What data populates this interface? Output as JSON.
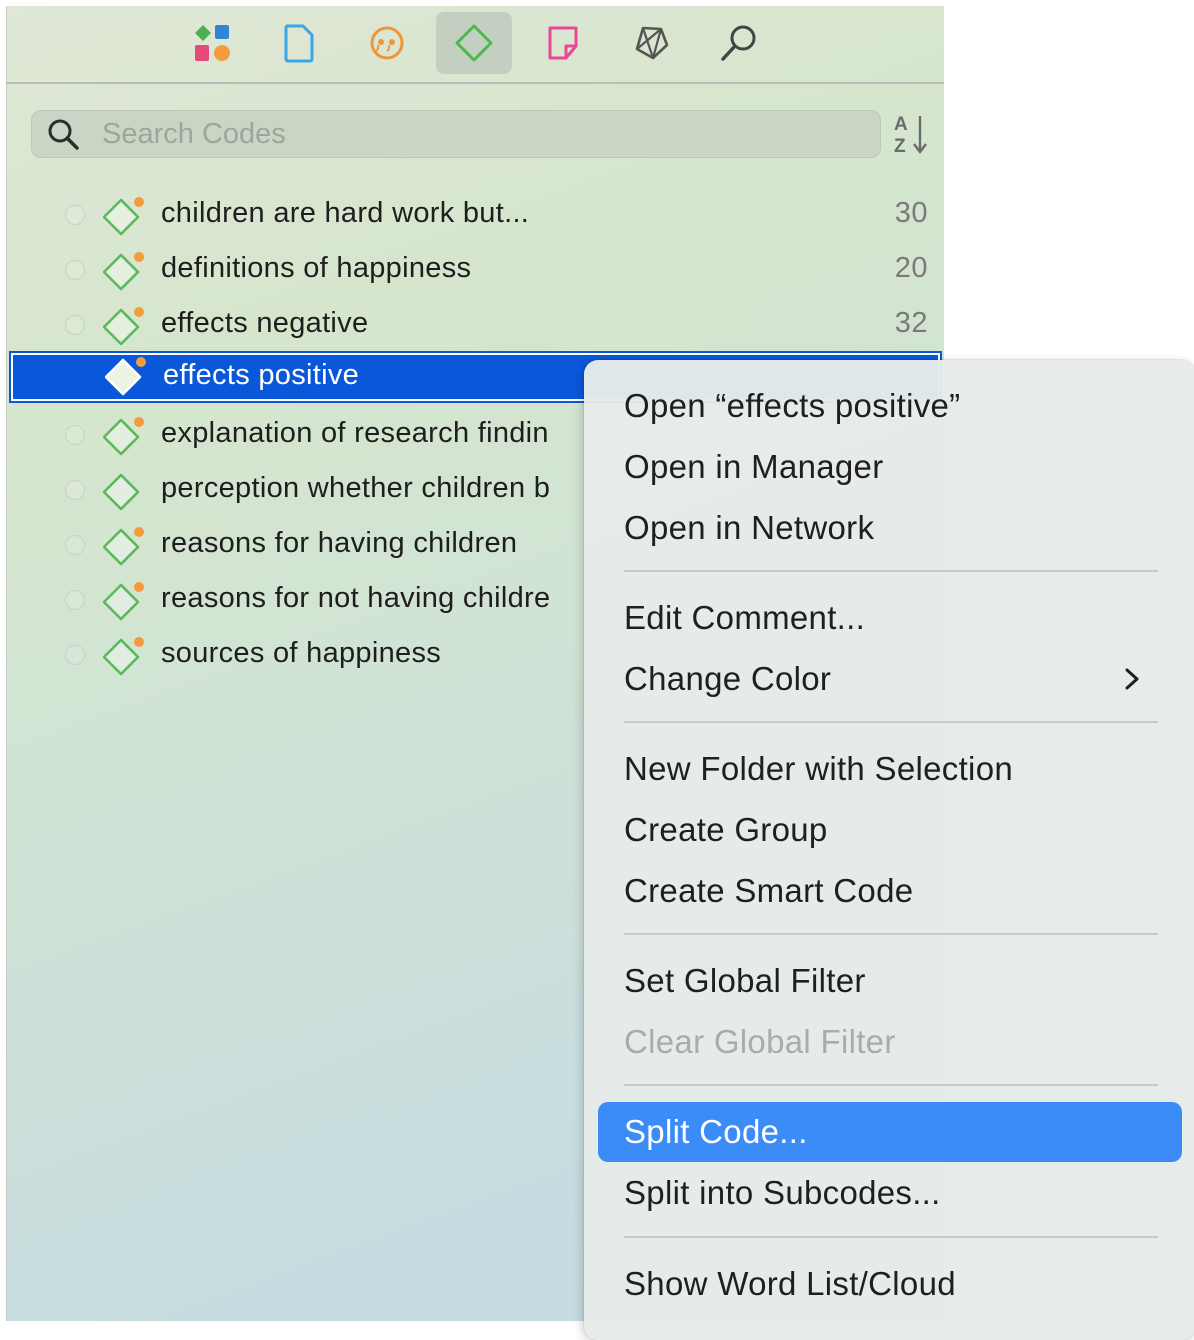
{
  "toolbar": {
    "icons": [
      {
        "name": "project-explorer-icon",
        "active": false
      },
      {
        "name": "documents-icon",
        "active": false
      },
      {
        "name": "quotations-icon",
        "active": false
      },
      {
        "name": "codes-icon",
        "active": true
      },
      {
        "name": "memos-icon",
        "active": false
      },
      {
        "name": "networks-icon",
        "active": false
      },
      {
        "name": "search-icon",
        "active": false
      }
    ]
  },
  "search": {
    "placeholder": "Search Codes",
    "value": ""
  },
  "sort_icon": "sort-az-icon",
  "codes": [
    {
      "label": "children are hard work but...",
      "count": "30"
    },
    {
      "label": "definitions of happiness",
      "count": "20"
    },
    {
      "label": "effects negative",
      "count": "32"
    },
    {
      "label": "effects positive",
      "count": "",
      "selected": true
    },
    {
      "label": "explanation of research findin",
      "count": ""
    },
    {
      "label": "perception whether children b",
      "count": ""
    },
    {
      "label": "reasons for having children",
      "count": ""
    },
    {
      "label": "reasons for not having childre",
      "count": ""
    },
    {
      "label": "sources of happiness",
      "count": ""
    }
  ],
  "context_menu": {
    "items": {
      "open": "Open “effects positive”",
      "open_manager": "Open in Manager",
      "open_network": "Open in Network",
      "edit_comment": "Edit Comment...",
      "change_color": "Change Color",
      "new_folder": "New Folder with Selection",
      "create_group": "Create Group",
      "create_smart_code": "Create Smart Code",
      "set_global_filter": "Set Global Filter",
      "clear_global_filter": "Clear Global Filter",
      "split_code": "Split Code...",
      "split_subcodes": "Split into Subcodes...",
      "word_list": "Show Word List/Cloud"
    }
  },
  "colors": {
    "selection": "#0a58d9",
    "menu_highlight": "#3b8cf6",
    "code_icon_green": "#5cb85c",
    "code_badge_orange": "#f39c3d"
  }
}
